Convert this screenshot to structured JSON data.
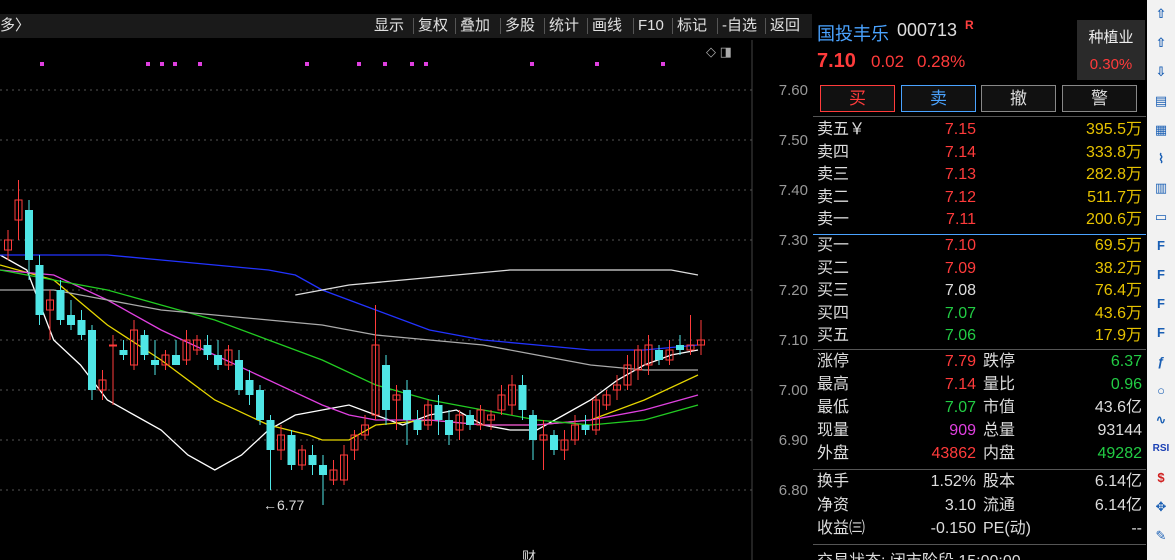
{
  "topbar": {
    "left_text": "多〉",
    "items": [
      "显示",
      "复权",
      "叠加",
      "多股",
      "统计",
      "画线",
      "F10",
      "标记",
      "-自选",
      "返回"
    ]
  },
  "chart_data": {
    "type": "candlestick",
    "ylim": [
      6.74,
      7.7
    ],
    "y_ticks": [
      "7.60",
      "7.50",
      "7.40",
      "7.30",
      "7.20",
      "7.10",
      "7.00",
      "6.90",
      "6.80"
    ],
    "min_marker": "6.77",
    "bottom_label": "财",
    "candles": [
      {
        "o": 7.28,
        "h": 7.32,
        "l": 7.26,
        "c": 7.3
      },
      {
        "o": 7.34,
        "h": 7.42,
        "l": 7.3,
        "c": 7.38
      },
      {
        "o": 7.36,
        "h": 7.38,
        "l": 7.22,
        "c": 7.26
      },
      {
        "o": 7.25,
        "h": 7.27,
        "l": 7.13,
        "c": 7.15
      },
      {
        "o": 7.16,
        "h": 7.2,
        "l": 7.1,
        "c": 7.18
      },
      {
        "o": 7.2,
        "h": 7.22,
        "l": 7.13,
        "c": 7.14
      },
      {
        "o": 7.15,
        "h": 7.18,
        "l": 7.12,
        "c": 7.13
      },
      {
        "o": 7.14,
        "h": 7.16,
        "l": 7.1,
        "c": 7.11
      },
      {
        "o": 7.12,
        "h": 7.13,
        "l": 6.98,
        "c": 7.0
      },
      {
        "o": 7.0,
        "h": 7.04,
        "l": 6.98,
        "c": 7.02
      },
      {
        "o": 7.09,
        "h": 7.11,
        "l": 6.97,
        "c": 7.09
      },
      {
        "o": 7.08,
        "h": 7.1,
        "l": 7.06,
        "c": 7.07
      },
      {
        "o": 7.05,
        "h": 7.14,
        "l": 7.04,
        "c": 7.12
      },
      {
        "o": 7.11,
        "h": 7.12,
        "l": 7.06,
        "c": 7.07
      },
      {
        "o": 7.06,
        "h": 7.1,
        "l": 7.03,
        "c": 7.05
      },
      {
        "o": 7.05,
        "h": 7.08,
        "l": 7.04,
        "c": 7.07
      },
      {
        "o": 7.07,
        "h": 7.1,
        "l": 7.05,
        "c": 7.05
      },
      {
        "o": 7.06,
        "h": 7.12,
        "l": 7.05,
        "c": 7.1
      },
      {
        "o": 7.08,
        "h": 7.11,
        "l": 7.07,
        "c": 7.1
      },
      {
        "o": 7.09,
        "h": 7.11,
        "l": 7.06,
        "c": 7.07
      },
      {
        "o": 7.07,
        "h": 7.1,
        "l": 7.04,
        "c": 7.05
      },
      {
        "o": 7.05,
        "h": 7.09,
        "l": 7.04,
        "c": 7.08
      },
      {
        "o": 7.06,
        "h": 7.08,
        "l": 6.99,
        "c": 7.0
      },
      {
        "o": 7.02,
        "h": 7.04,
        "l": 6.97,
        "c": 6.99
      },
      {
        "o": 7.0,
        "h": 7.01,
        "l": 6.93,
        "c": 6.94
      },
      {
        "o": 6.94,
        "h": 6.95,
        "l": 6.8,
        "c": 6.88
      },
      {
        "o": 6.88,
        "h": 6.93,
        "l": 6.86,
        "c": 6.91
      },
      {
        "o": 6.91,
        "h": 6.92,
        "l": 6.84,
        "c": 6.85
      },
      {
        "o": 6.85,
        "h": 6.89,
        "l": 6.84,
        "c": 6.88
      },
      {
        "o": 6.87,
        "h": 6.89,
        "l": 6.83,
        "c": 6.85
      },
      {
        "o": 6.85,
        "h": 6.87,
        "l": 6.77,
        "c": 6.83
      },
      {
        "o": 6.82,
        "h": 6.86,
        "l": 6.81,
        "c": 6.84
      },
      {
        "o": 6.82,
        "h": 6.89,
        "l": 6.81,
        "c": 6.87
      },
      {
        "o": 6.88,
        "h": 6.92,
        "l": 6.86,
        "c": 6.91
      },
      {
        "o": 6.91,
        "h": 6.95,
        "l": 6.9,
        "c": 6.93
      },
      {
        "o": 6.95,
        "h": 7.17,
        "l": 6.94,
        "c": 7.09
      },
      {
        "o": 7.05,
        "h": 7.07,
        "l": 6.93,
        "c": 6.96
      },
      {
        "o": 6.98,
        "h": 7.01,
        "l": 6.92,
        "c": 6.99
      },
      {
        "o": 7.0,
        "h": 7.02,
        "l": 6.89,
        "c": 6.94
      },
      {
        "o": 6.94,
        "h": 6.96,
        "l": 6.91,
        "c": 6.92
      },
      {
        "o": 6.93,
        "h": 6.98,
        "l": 6.92,
        "c": 6.97
      },
      {
        "o": 6.97,
        "h": 6.99,
        "l": 6.91,
        "c": 6.94
      },
      {
        "o": 6.94,
        "h": 6.96,
        "l": 6.89,
        "c": 6.91
      },
      {
        "o": 6.92,
        "h": 6.96,
        "l": 6.9,
        "c": 6.95
      },
      {
        "o": 6.95,
        "h": 6.96,
        "l": 6.92,
        "c": 6.93
      },
      {
        "o": 6.93,
        "h": 6.97,
        "l": 6.92,
        "c": 6.96
      },
      {
        "o": 6.94,
        "h": 6.96,
        "l": 6.92,
        "c": 6.95
      },
      {
        "o": 6.96,
        "h": 7.01,
        "l": 6.95,
        "c": 6.99
      },
      {
        "o": 6.97,
        "h": 7.03,
        "l": 6.95,
        "c": 7.01
      },
      {
        "o": 7.01,
        "h": 7.03,
        "l": 6.94,
        "c": 6.96
      },
      {
        "o": 6.95,
        "h": 6.96,
        "l": 6.86,
        "c": 6.9
      },
      {
        "o": 6.9,
        "h": 6.94,
        "l": 6.84,
        "c": 6.91
      },
      {
        "o": 6.91,
        "h": 6.92,
        "l": 6.87,
        "c": 6.88
      },
      {
        "o": 6.88,
        "h": 6.92,
        "l": 6.86,
        "c": 6.9
      },
      {
        "o": 6.9,
        "h": 6.95,
        "l": 6.89,
        "c": 6.93
      },
      {
        "o": 6.93,
        "h": 6.95,
        "l": 6.91,
        "c": 6.92
      },
      {
        "o": 6.92,
        "h": 6.99,
        "l": 6.91,
        "c": 6.98
      },
      {
        "o": 6.97,
        "h": 7.0,
        "l": 6.96,
        "c": 6.99
      },
      {
        "o": 7.0,
        "h": 7.03,
        "l": 6.98,
        "c": 7.01
      },
      {
        "o": 7.01,
        "h": 7.07,
        "l": 7.0,
        "c": 7.05
      },
      {
        "o": 7.04,
        "h": 7.09,
        "l": 7.02,
        "c": 7.08
      },
      {
        "o": 7.05,
        "h": 7.11,
        "l": 7.03,
        "c": 7.09
      },
      {
        "o": 7.08,
        "h": 7.09,
        "l": 7.05,
        "c": 7.06
      },
      {
        "o": 7.06,
        "h": 7.1,
        "l": 7.05,
        "c": 7.08
      },
      {
        "o": 7.09,
        "h": 7.11,
        "l": 7.07,
        "c": 7.08
      },
      {
        "o": 7.08,
        "h": 7.15,
        "l": 7.07,
        "c": 7.09
      },
      {
        "o": 7.09,
        "h": 7.14,
        "l": 7.07,
        "c": 7.1
      }
    ],
    "ma_series": [
      {
        "color": "#ffffff",
        "points": [
          [
            0,
            7.27
          ],
          [
            10,
            7.24
          ],
          [
            20,
            7.1
          ],
          [
            30,
            7.05
          ],
          [
            40,
            6.98
          ],
          [
            50,
            6.95
          ],
          [
            60,
            6.92
          ],
          [
            70,
            6.87
          ],
          [
            80,
            6.84
          ],
          [
            90,
            6.87
          ],
          [
            100,
            6.92
          ],
          [
            110,
            6.95
          ],
          [
            120,
            6.96
          ],
          [
            130,
            6.97
          ],
          [
            140,
            6.95
          ],
          [
            150,
            6.93
          ],
          [
            160,
            6.95
          ],
          [
            170,
            6.96
          ],
          [
            180,
            6.93
          ],
          [
            190,
            6.92
          ],
          [
            200,
            6.92
          ],
          [
            210,
            6.95
          ],
          [
            220,
            6.98
          ],
          [
            230,
            7.02
          ],
          [
            240,
            7.05
          ],
          [
            250,
            7.07
          ],
          [
            260,
            7.08
          ]
        ]
      },
      {
        "color": "#e6d600",
        "points": [
          [
            0,
            7.25
          ],
          [
            20,
            7.22
          ],
          [
            40,
            7.13
          ],
          [
            60,
            7.06
          ],
          [
            80,
            6.98
          ],
          [
            100,
            6.93
          ],
          [
            115,
            6.91
          ],
          [
            120,
            6.9
          ],
          [
            130,
            6.9
          ],
          [
            140,
            6.93
          ],
          [
            160,
            6.94
          ],
          [
            180,
            6.93
          ],
          [
            200,
            6.93
          ],
          [
            220,
            6.94
          ],
          [
            240,
            6.98
          ],
          [
            260,
            7.03
          ]
        ]
      },
      {
        "color": "#e040e0",
        "points": [
          [
            0,
            7.24
          ],
          [
            20,
            7.23
          ],
          [
            40,
            7.18
          ],
          [
            60,
            7.12
          ],
          [
            80,
            7.07
          ],
          [
            100,
            7.02
          ],
          [
            120,
            6.97
          ],
          [
            130,
            6.95
          ],
          [
            140,
            6.94
          ],
          [
            160,
            6.94
          ],
          [
            180,
            6.93
          ],
          [
            200,
            6.93
          ],
          [
            220,
            6.94
          ],
          [
            240,
            6.96
          ],
          [
            260,
            6.99
          ]
        ]
      },
      {
        "color": "#22cc22",
        "points": [
          [
            0,
            7.24
          ],
          [
            20,
            7.22
          ],
          [
            40,
            7.2
          ],
          [
            60,
            7.17
          ],
          [
            80,
            7.14
          ],
          [
            100,
            7.1
          ],
          [
            120,
            7.06
          ],
          [
            140,
            7.01
          ],
          [
            160,
            6.98
          ],
          [
            180,
            6.96
          ],
          [
            200,
            6.94
          ],
          [
            220,
            6.93
          ],
          [
            240,
            6.94
          ],
          [
            260,
            6.97
          ]
        ]
      },
      {
        "color": "#aaaaaa",
        "points": [
          [
            0,
            7.2
          ],
          [
            20,
            7.2
          ],
          [
            40,
            7.18
          ],
          [
            60,
            7.16
          ],
          [
            80,
            7.15
          ],
          [
            100,
            7.14
          ],
          [
            120,
            7.13
          ],
          [
            140,
            7.11
          ],
          [
            160,
            7.1
          ],
          [
            180,
            7.09
          ],
          [
            200,
            7.07
          ],
          [
            220,
            7.05
          ],
          [
            240,
            7.04
          ],
          [
            260,
            7.04
          ]
        ]
      },
      {
        "color": "#2233ff",
        "points": [
          [
            0,
            7.27
          ],
          [
            20,
            7.27
          ],
          [
            40,
            7.27
          ],
          [
            60,
            7.26
          ],
          [
            80,
            7.25
          ],
          [
            100,
            7.24
          ],
          [
            110,
            7.23
          ],
          [
            120,
            7.2
          ],
          [
            140,
            7.16
          ],
          [
            160,
            7.12
          ],
          [
            180,
            7.1
          ],
          [
            200,
            7.09
          ],
          [
            220,
            7.08
          ],
          [
            240,
            7.08
          ],
          [
            260,
            7.09
          ]
        ]
      },
      {
        "color": "#dddddd",
        "points": [
          [
            110,
            7.19
          ],
          [
            130,
            7.21
          ],
          [
            150,
            7.22
          ],
          [
            170,
            7.23
          ],
          [
            190,
            7.24
          ],
          [
            210,
            7.24
          ],
          [
            230,
            7.24
          ],
          [
            250,
            7.24
          ],
          [
            260,
            7.23
          ]
        ]
      }
    ]
  },
  "stock": {
    "name": "国投丰乐",
    "code": "000713",
    "mark": "R",
    "sector_name": "种植业",
    "sector_pct": "0.30%",
    "price": "7.10",
    "change": "0.02",
    "change_pct": "0.28%"
  },
  "trade_buttons": [
    "买",
    "卖",
    "撤",
    "警"
  ],
  "asks": [
    {
      "label": "卖五￥",
      "price": "7.15",
      "vol": "395.5万"
    },
    {
      "label": "卖四",
      "price": "7.14",
      "vol": "333.8万"
    },
    {
      "label": "卖三",
      "price": "7.13",
      "vol": "282.8万"
    },
    {
      "label": "卖二",
      "price": "7.12",
      "vol": "511.7万"
    },
    {
      "label": "卖一",
      "price": "7.11",
      "vol": "200.6万"
    }
  ],
  "bids": [
    {
      "label": "买一",
      "price": "7.10",
      "vol": "69.5万",
      "color": "red"
    },
    {
      "label": "买二",
      "price": "7.09",
      "vol": "38.2万",
      "color": "red"
    },
    {
      "label": "买三",
      "price": "7.08",
      "vol": "76.4万",
      "color": "white"
    },
    {
      "label": "买四",
      "price": "7.07",
      "vol": "43.6万",
      "color": "green"
    },
    {
      "label": "买五",
      "price": "7.06",
      "vol": "17.9万",
      "color": "green"
    }
  ],
  "stats": [
    {
      "l1": "涨停",
      "v1": "7.79",
      "c1": "red",
      "l2": "跌停",
      "v2": "6.37",
      "c2": "green"
    },
    {
      "l1": "最高",
      "v1": "7.14",
      "c1": "red",
      "l2": "量比",
      "v2": "0.96",
      "c2": "green"
    },
    {
      "l1": "最低",
      "v1": "7.07",
      "c1": "green",
      "l2": "市值",
      "v2": "43.6亿",
      "c2": "white"
    },
    {
      "l1": "现量",
      "v1": "909",
      "c1": "magenta",
      "l2": "总量",
      "v2": "93144",
      "c2": "white"
    },
    {
      "l1": "外盘",
      "v1": "43862",
      "c1": "red",
      "l2": "内盘",
      "v2": "49282",
      "c2": "green"
    }
  ],
  "fund": [
    {
      "l1": "换手",
      "v1": "1.52%",
      "l2": "股本",
      "v2": "6.14亿"
    },
    {
      "l1": "净资",
      "v1": "3.10",
      "l2": "流通",
      "v2": "6.14亿"
    },
    {
      "l1": "收益㈢",
      "v1": "-0.150",
      "l2": "PE(动)",
      "v2": "--"
    }
  ],
  "status_text": "交易状态: 闭市阶段 15:00:00",
  "tools": [
    "arrow-up-icon",
    "arrow-up2-icon",
    "arrow-down-icon",
    "chart-icon",
    "table-icon",
    "line-icon",
    "candle-icon",
    "list-icon",
    "F10",
    "F10b",
    "F10c",
    "F12",
    "fx-icon",
    "circle-icon",
    "wave-icon",
    "RSI",
    "dollar-icon",
    "move-icon",
    "pen-icon"
  ]
}
